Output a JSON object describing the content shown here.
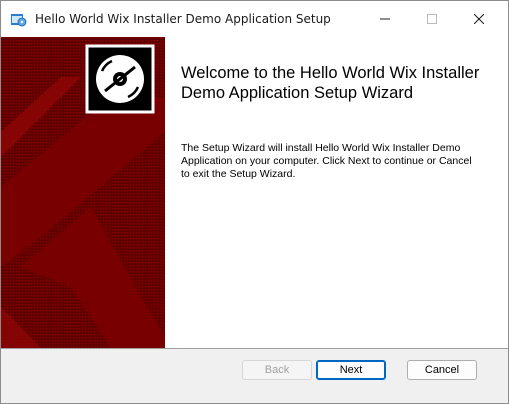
{
  "window": {
    "title": "Hello World Wix Installer Demo Application Setup"
  },
  "titlebar_buttons": {
    "minimize_icon": "minimize-icon",
    "maximize_icon": "maximize-icon",
    "close_icon": "close-icon"
  },
  "wizard": {
    "heading": "Welcome to the Hello World Wix Installer Demo Application Setup Wizard",
    "description": "The Setup Wizard will install Hello World Wix Installer Demo Application on your computer. Click Next to continue or Cancel to exit the Setup Wizard."
  },
  "buttons": {
    "back_label": "Back",
    "next_label": "Next",
    "cancel_label": "Cancel"
  },
  "colors": {
    "side_panel": "#7a0000",
    "side_panel_light": "#9a0a0a",
    "accent": "#0067c0"
  }
}
